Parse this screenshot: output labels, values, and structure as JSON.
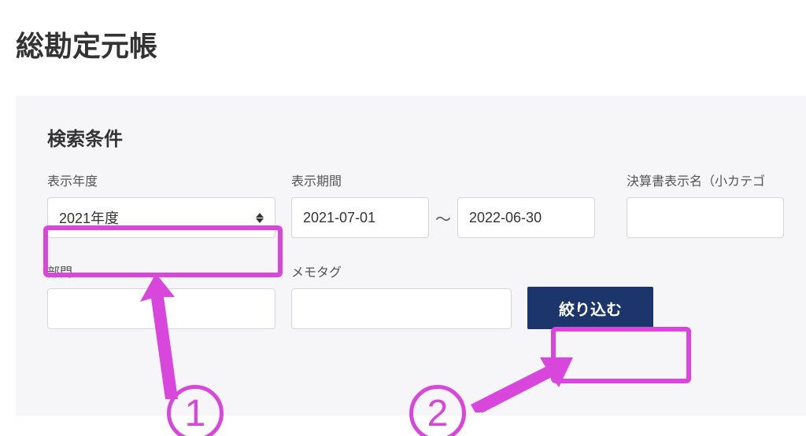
{
  "title": "総勘定元帳",
  "panel": {
    "heading": "検索条件",
    "year_label": "表示年度",
    "year_value": "2021年度",
    "period_label": "表示期間",
    "period_from": "2021-07-01",
    "period_sep": "〜",
    "period_to": "2022-06-30",
    "kessan_label": "決算書表示名（小カテゴ",
    "dept_label": "部門",
    "memo_label": "メモタグ",
    "submit_label": "絞り込む"
  },
  "annotations": {
    "marker1": "1",
    "marker2": "2"
  },
  "colors": {
    "highlight": "#d946db",
    "button_bg": "#1c366b",
    "panel_bg": "#f6f6f8"
  }
}
